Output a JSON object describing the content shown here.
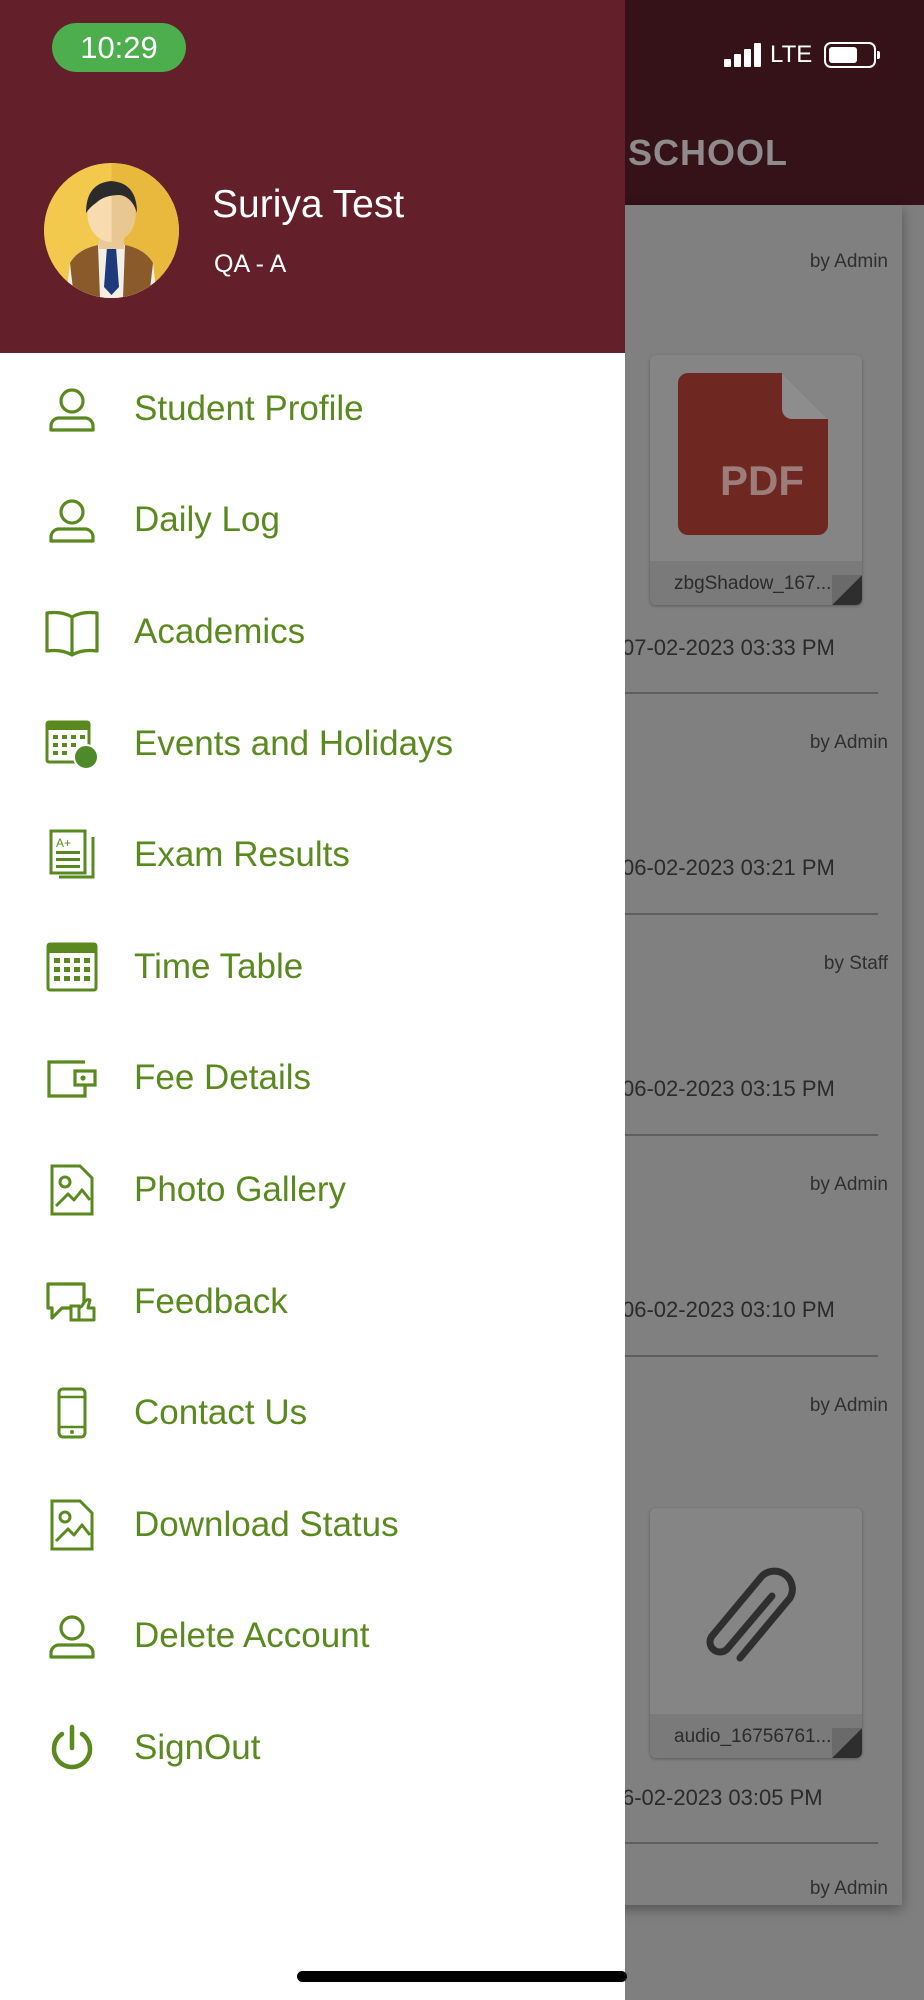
{
  "status_bar": {
    "time": "10:29",
    "network": "LTE"
  },
  "background": {
    "header_title": "SCHOOL",
    "items": [
      {
        "by": "by Admin",
        "date": "07-02-2023 03:33 PM",
        "attachment": {
          "type": "PDF",
          "name": "zbgShadow_167..."
        }
      },
      {
        "by": "by Admin",
        "date": "06-02-2023 03:21 PM"
      },
      {
        "by": "by Staff",
        "date": "06-02-2023 03:15 PM"
      },
      {
        "by": "by Admin",
        "date": "06-02-2023 03:10 PM"
      },
      {
        "by": "by Admin",
        "date": "6-02-2023 03:05 PM",
        "attachment": {
          "type": "file",
          "name": "audio_16756761..."
        }
      },
      {
        "by": "by Admin"
      }
    ]
  },
  "drawer": {
    "user": {
      "name": "Suriya Test",
      "class": "QA - A"
    },
    "menu": [
      {
        "label": "Student Profile",
        "icon": "person-icon"
      },
      {
        "label": "Daily Log",
        "icon": "person-icon"
      },
      {
        "label": "Academics",
        "icon": "book-icon"
      },
      {
        "label": "Events and Holidays",
        "icon": "calendar-event-icon"
      },
      {
        "label": "Exam Results",
        "icon": "exam-results-icon"
      },
      {
        "label": "Time Table",
        "icon": "calendar-grid-icon"
      },
      {
        "label": "Fee Details",
        "icon": "wallet-icon"
      },
      {
        "label": "Photo Gallery",
        "icon": "image-icon"
      },
      {
        "label": "Feedback",
        "icon": "feedback-icon"
      },
      {
        "label": "Contact Us",
        "icon": "phone-icon"
      },
      {
        "label": "Download Status",
        "icon": "image-icon"
      },
      {
        "label": "Delete Account",
        "icon": "person-icon"
      },
      {
        "label": "SignOut",
        "icon": "power-icon"
      }
    ]
  },
  "colors": {
    "drawer_header": "#63202b",
    "menu_text": "#5a8a1f",
    "time_pill": "#4cae4c"
  }
}
